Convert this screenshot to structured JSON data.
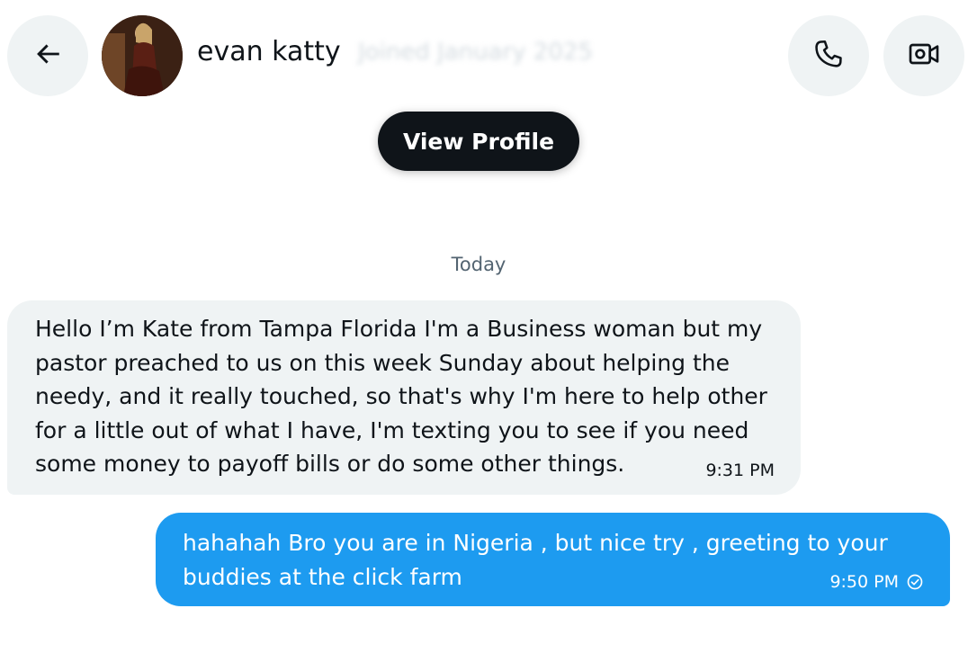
{
  "header": {
    "back_icon": "arrow-left-icon",
    "display_name": "evan katty",
    "joined_text": "Joined January 2025",
    "call_icon": "phone-icon",
    "video_icon": "video-camera-icon"
  },
  "profile": {
    "view_profile_label": "View Profile"
  },
  "conversation": {
    "day_separator": "Today",
    "messages": [
      {
        "direction": "incoming",
        "lines": [
          "Hello I’m Kate from Tampa Florida I'm a Business woman but my",
          "pastor preached to us on this week Sunday about helping the",
          "needy, and it really touched, so that's why I'm here to help other",
          "for a little out of what I have, I'm texting you to see if you need",
          "some money to payoff bills or do some other things."
        ],
        "time": "9:31 PM"
      },
      {
        "direction": "outgoing",
        "lines": [
          "hahahah Bro you are in Nigeria , but nice try , greeting to your",
          "buddies at the click farm"
        ],
        "time": "9:50 PM",
        "status_icon": "check-circle-icon"
      }
    ]
  },
  "colors": {
    "outgoing_bubble": "#1d9bf0",
    "incoming_bubble": "#eff3f4",
    "primary_text": "#0f1419",
    "secondary_text": "#536471",
    "button_dark": "#0f1419"
  }
}
